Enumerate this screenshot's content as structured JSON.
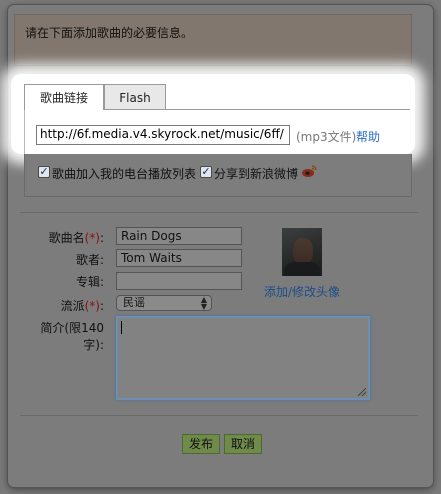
{
  "info": {
    "message": "请在下面添加歌曲的必要信息。"
  },
  "tabs": [
    {
      "label": "歌曲链接",
      "active": true
    },
    {
      "label": "Flash",
      "active": false
    }
  ],
  "link": {
    "url_value": "http://6f.media.v4.skyrock.net/music/6ff/",
    "hint": "(mp3文件)",
    "help": "帮助"
  },
  "options": {
    "add_to_playlist": {
      "label": "歌曲加入我的电台播放列表",
      "checked": true
    },
    "share_weibo": {
      "label": "分享到新浪微博",
      "checked": true
    },
    "weibo_icon": "sina-weibo-icon"
  },
  "form": {
    "song_name": {
      "label": "歌曲名",
      "required_mark": "(*)",
      "suffix": ":",
      "value": "Rain Dogs"
    },
    "artist": {
      "label": "歌者:",
      "value": "Tom Waits"
    },
    "album": {
      "label": "专辑:",
      "value": ""
    },
    "genre": {
      "label": "流派",
      "required_mark": "(*)",
      "suffix": ":",
      "value": "民谣"
    },
    "intro": {
      "label": "简介(限140字):",
      "value": ""
    }
  },
  "avatar": {
    "link": "添加/修改头像"
  },
  "buttons": {
    "publish": "发布",
    "cancel": "取消"
  }
}
